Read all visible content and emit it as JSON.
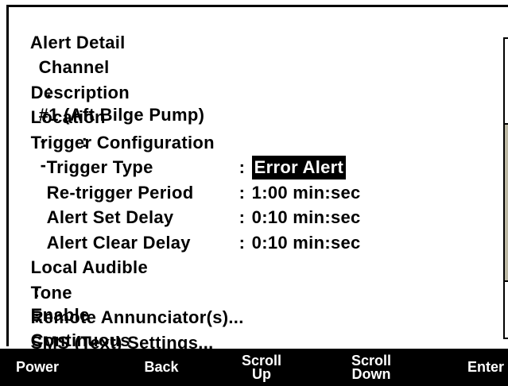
{
  "screen": {
    "title": "Alert Detail",
    "channel": {
      "label": "Channel",
      "colon": ":",
      "value": "#1 (Aft Bilge Pump)"
    },
    "description": {
      "label": "Description",
      "colon": ":",
      "value": "-"
    },
    "location": {
      "label": "Location",
      "colon": ":",
      "value": "-"
    },
    "trigger_configuration": {
      "heading": "Trigger Configuration",
      "fields": [
        {
          "label": "Trigger Type",
          "colon": ":",
          "value": "Error Alert",
          "selected": true
        },
        {
          "label": "Re-trigger Period",
          "colon": ":",
          "value": "1:00 min:sec"
        },
        {
          "label": "Alert Set Delay",
          "colon": ":",
          "value": "0:10 min:sec"
        },
        {
          "label": "Alert Clear Delay",
          "colon": ":",
          "value": "0:10 min:sec"
        }
      ]
    },
    "local_audible": {
      "label": "Local Audible",
      "colon": ":",
      "value": "Enable"
    },
    "tone": {
      "label": "Tone",
      "colon": ":",
      "value": "Continuous"
    },
    "remote_annunciators": {
      "label": "Remote Annunciator(s)..."
    },
    "sms_settings": {
      "label": "SMS (Text) Settings..."
    }
  },
  "softkeys": [
    {
      "line1": "Power",
      "line2": ""
    },
    {
      "line1": "Back",
      "line2": ""
    },
    {
      "line1": "Scroll",
      "line2": "Up"
    },
    {
      "line1": "Scroll",
      "line2": "Down"
    },
    {
      "line1": "Enter",
      "line2": ""
    }
  ],
  "colors": {
    "background": "#ffffff",
    "foreground": "#000000",
    "selection_bg": "#000000",
    "selection_fg": "#ffffff",
    "scroll_thumb": "#bdb9a5"
  }
}
